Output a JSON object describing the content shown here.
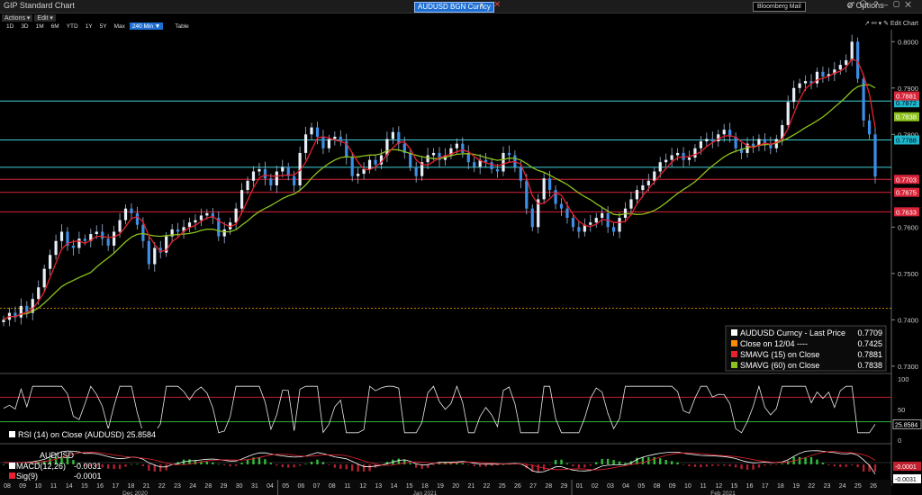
{
  "window": {
    "title": "GIP Standard Chart",
    "ticker": "AUDUSD BGN Curncy",
    "mail_label": "Bloomberg Mail",
    "options_label": "Options",
    "icons": [
      "pin-icon",
      "share-icon",
      "question-icon",
      "minimize-icon",
      "maximize-icon",
      "close-icon"
    ]
  },
  "menu": {
    "actions": "Actions ▾",
    "edit": "Edit ▾"
  },
  "ranges": {
    "items": [
      "1D",
      "3D",
      "1M",
      "6M",
      "YTD",
      "1Y",
      "5Y",
      "Max"
    ],
    "active": "240 Min ▼",
    "table": "Table"
  },
  "toolbar": {
    "icons": "↗ ⚯ ▾",
    "edit_chart": "✎ Edit Chart"
  },
  "colors": {
    "bg": "#000000",
    "candle": "#3c8ee6",
    "sma15": "#e8212d",
    "sma60": "#8dc11c",
    "cyan": "#3fd0d6",
    "red_line": "#d8253a",
    "orange": "#ffa500"
  },
  "chart_data": [
    {
      "type": "line",
      "title": "",
      "ylim": [
        0.729,
        0.802
      ],
      "y_ticks": [
        "0.8000",
        "0.7900",
        "0.7800",
        "0.7600",
        "0.7500",
        "0.7400",
        "0.7300"
      ],
      "series": [
        {
          "name": "AUDUSD Curncy - Last Price",
          "last": "0.7709",
          "values": [
            0.74,
            0.7415,
            0.7405,
            0.743,
            0.7415,
            0.7445,
            0.747,
            0.751,
            0.754,
            0.757,
            0.759,
            0.756,
            0.7555,
            0.7575,
            0.757,
            0.7585,
            0.759,
            0.7575,
            0.756,
            0.759,
            0.7615,
            0.764,
            0.763,
            0.7605,
            0.757,
            0.752,
            0.7555,
            0.7545,
            0.758,
            0.7595,
            0.759,
            0.76,
            0.761,
            0.7615,
            0.7625,
            0.763,
            0.762,
            0.758,
            0.7595,
            0.761,
            0.764,
            0.768,
            0.77,
            0.772,
            0.7725,
            0.7705,
            0.769,
            0.772,
            0.773,
            0.771,
            0.769,
            0.776,
            0.78,
            0.7815,
            0.7795,
            0.777,
            0.779,
            0.7795,
            0.7785,
            0.775,
            0.771,
            0.7715,
            0.7725,
            0.7745,
            0.7735,
            0.7755,
            0.779,
            0.7805,
            0.778,
            0.776,
            0.773,
            0.771,
            0.774,
            0.7755,
            0.776,
            0.7745,
            0.7755,
            0.777,
            0.778,
            0.776,
            0.774,
            0.773,
            0.7745,
            0.774,
            0.7725,
            0.772,
            0.776,
            0.7755,
            0.773,
            0.77,
            0.764,
            0.76,
            0.766,
            0.7705,
            0.768,
            0.765,
            0.764,
            0.762,
            0.76,
            0.759,
            0.7605,
            0.761,
            0.762,
            0.763,
            0.76,
            0.759,
            0.762,
            0.764,
            0.766,
            0.768,
            0.769,
            0.77,
            0.772,
            0.774,
            0.7745,
            0.7755,
            0.776,
            0.7745,
            0.775,
            0.777,
            0.7785,
            0.779,
            0.7785,
            0.78,
            0.781,
            0.7795,
            0.777,
            0.776,
            0.778,
            0.7775,
            0.779,
            0.778,
            0.777,
            0.779,
            0.782,
            0.787,
            0.79,
            0.791,
            0.7915,
            0.791,
            0.7935,
            0.7925,
            0.793,
            0.794,
            0.795,
            0.796,
            0.8,
            0.792,
            0.783,
            0.78,
            0.7709
          ]
        },
        {
          "name": "SMAVG (15) on Close",
          "last": "0.7881",
          "values": "derived"
        },
        {
          "name": "SMAVG (60) on Close",
          "last": "0.7838",
          "values": "derived"
        },
        {
          "name": "Close on 12/04",
          "last": "0.7425",
          "values": "constant"
        }
      ],
      "horizontal_lines": {
        "cyan": [
          0.7872,
          0.7788,
          0.7729
        ],
        "red": [
          0.7703,
          0.7675,
          0.7633
        ]
      },
      "price_labels": [
        {
          "text": "0.7872",
          "color": "cyan"
        },
        {
          "text": "0.7788",
          "color": "cyan"
        },
        {
          "text": "0.7881",
          "color": "red"
        },
        {
          "text": "0.7838",
          "color": "green"
        },
        {
          "text": "0.7703",
          "color": "red"
        },
        {
          "text": "0.7675",
          "color": "red"
        },
        {
          "text": "0.7633",
          "color": "red"
        }
      ],
      "legend": [
        {
          "label": "AUDUSD Curncy - Last Price",
          "value": "0.7709",
          "color": "#ffffff"
        },
        {
          "label": "Close on 12/04 ----",
          "value": "0.7425",
          "color": "#ff8c00"
        },
        {
          "label": "SMAVG (15)  on Close",
          "value": "0.7881",
          "color": "#e8212d"
        },
        {
          "label": "SMAVG (60)  on Close",
          "value": "0.7838",
          "color": "#8dc11c"
        }
      ],
      "legend_position": "bottom-right"
    },
    {
      "type": "line",
      "title": "RSI (14)  on Close (AUDUSD) 25.8584",
      "ylim": [
        0,
        100
      ],
      "y_ticks": [
        "100",
        "50",
        "25",
        "0"
      ],
      "last": "25.8584",
      "levels": [
        70,
        30
      ]
    },
    {
      "type": "bar",
      "title": "AUDUSD",
      "series": [
        {
          "name": "MACD(12,26)",
          "last": "-0.0031"
        },
        {
          "name": "Sig(9)",
          "last": "-0.0001"
        }
      ],
      "right_labels": [
        "-0.0001",
        "-0.0031"
      ]
    }
  ],
  "x_axis": {
    "days": [
      "08",
      "09",
      "10",
      "11",
      "14",
      "15",
      "16",
      "17",
      "18",
      "21",
      "22",
      "23",
      "24",
      "28",
      "29",
      "30",
      "31",
      "04",
      "05",
      "06",
      "07",
      "08",
      "11",
      "12",
      "13",
      "14",
      "15",
      "18",
      "19",
      "20",
      "21",
      "22",
      "25",
      "26",
      "27",
      "28",
      "29",
      "01",
      "02",
      "03",
      "04",
      "05",
      "08",
      "09",
      "10",
      "11",
      "12",
      "15",
      "16",
      "17",
      "18",
      "19",
      "22",
      "23",
      "24",
      "25",
      "26"
    ],
    "months": [
      "Dec 2020",
      "Jan 2021",
      "Feb 2021"
    ]
  }
}
